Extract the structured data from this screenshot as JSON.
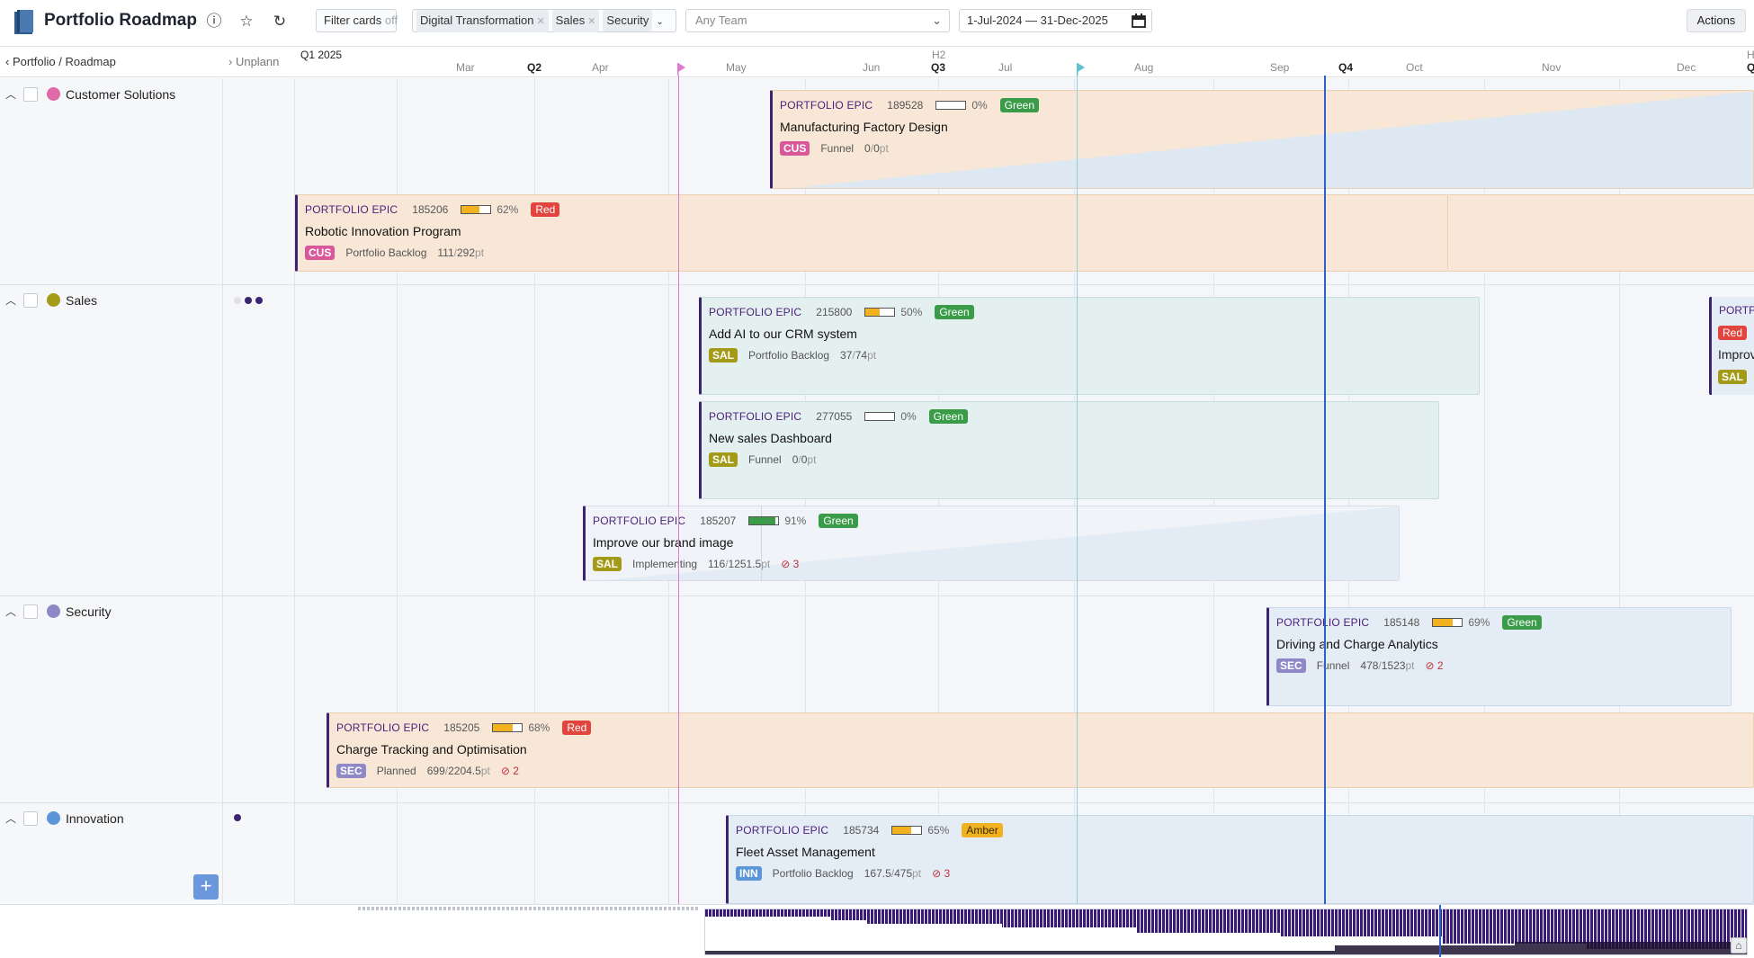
{
  "app": {
    "title": "Portfolio Roadmap",
    "filter_label": "Filter cards",
    "filter_state": "off",
    "tags": [
      "Digital Transformation",
      "Sales",
      "Security"
    ],
    "team_placeholder": "Any Team",
    "date_range": "1-Jul-2024 — 31-Dec-2025",
    "actions_label": "Actions"
  },
  "header": {
    "breadcrumb": "Portfolio / Roadmap",
    "unplanned": "Unplann",
    "q1_label": "Q1 2025",
    "h2_label": "H2",
    "h_edge": "H",
    "months": [
      "Mar",
      "Apr",
      "May",
      "Jun",
      "Jul",
      "Aug",
      "Sep",
      "Oct",
      "Nov",
      "Dec"
    ],
    "quarters": [
      "Q2",
      "Q3",
      "Q4",
      "Q"
    ]
  },
  "lanes": [
    {
      "name": "Customer Solutions",
      "color": "#e06aa8"
    },
    {
      "name": "Sales",
      "color": "#a39a17"
    },
    {
      "name": "Security",
      "color": "#8f88c7"
    },
    {
      "name": "Innovation",
      "color": "#5b97d8"
    }
  ],
  "cards": [
    {
      "type": "PORTFOLIO EPIC",
      "id": "189528",
      "pct": "0",
      "status": "Green",
      "title": "Manufacturing Factory Design",
      "team": "CUS",
      "stage": "Funnel",
      "done": "0",
      "total": "0",
      "unit": "pt",
      "blocked": ""
    },
    {
      "type": "PORTFOLIO EPIC",
      "id": "185206",
      "pct": "62",
      "status": "Red",
      "title": "Robotic Innovation Program",
      "team": "CUS",
      "stage": "Portfolio Backlog",
      "done": "111",
      "total": "292",
      "unit": "pt",
      "blocked": ""
    },
    {
      "type": "PORTFOLIO EPIC",
      "id": "215800",
      "pct": "50",
      "status": "Green",
      "title": "Add AI to our CRM system",
      "team": "SAL",
      "stage": "Portfolio Backlog",
      "done": "37",
      "total": "74",
      "unit": "pt",
      "blocked": ""
    },
    {
      "type": "PORTFOLIO EPIC",
      "id": "277055",
      "pct": "0",
      "status": "Green",
      "title": "New sales Dashboard",
      "team": "SAL",
      "stage": "Funnel",
      "done": "0",
      "total": "0",
      "unit": "pt",
      "blocked": ""
    },
    {
      "type": "PORTFOLIO EPIC",
      "id": "185207",
      "pct": "91",
      "status": "Green",
      "title": "Improve our brand image",
      "team": "SAL",
      "stage": "Implementing",
      "done": "116",
      "total": "1251.5",
      "unit": "pt",
      "blocked": "3"
    },
    {
      "type": "PORTFOLIO EPIC",
      "id": "185148",
      "pct": "69",
      "status": "Green",
      "title": "Driving and Charge Analytics",
      "team": "SEC",
      "stage": "Funnel",
      "done": "478",
      "total": "1523",
      "unit": "pt",
      "blocked": "2"
    },
    {
      "type": "PORTFOLIO EPIC",
      "id": "185205",
      "pct": "68",
      "status": "Red",
      "title": "Charge Tracking and Optimisation",
      "team": "SEC",
      "stage": "Planned",
      "done": "699",
      "total": "2204.5",
      "unit": "pt",
      "blocked": "2"
    },
    {
      "type": "PORTFOLIO EPIC",
      "id": "185734",
      "pct": "65",
      "status": "Amber",
      "title": "Fleet Asset Management",
      "team": "INN",
      "stage": "Portfolio Backlog",
      "done": "167.5",
      "total": "475",
      "unit": "pt",
      "blocked": "3"
    }
  ],
  "edge_card": {
    "type": "PORTF",
    "status": "Red",
    "title": "Improv",
    "team": "SAL"
  },
  "colors": {
    "green": "#3a9c48",
    "red": "#e2453d",
    "amber": "#f2b21f",
    "CUS": "#d9589a",
    "SAL": "#a39a17",
    "SEC": "#8f88c7",
    "INN": "#5b97d8",
    "today_line": "#2f62c9",
    "pink_marker": "#e07ad0",
    "teal_marker": "#8fcfd6"
  },
  "add_label": "+"
}
